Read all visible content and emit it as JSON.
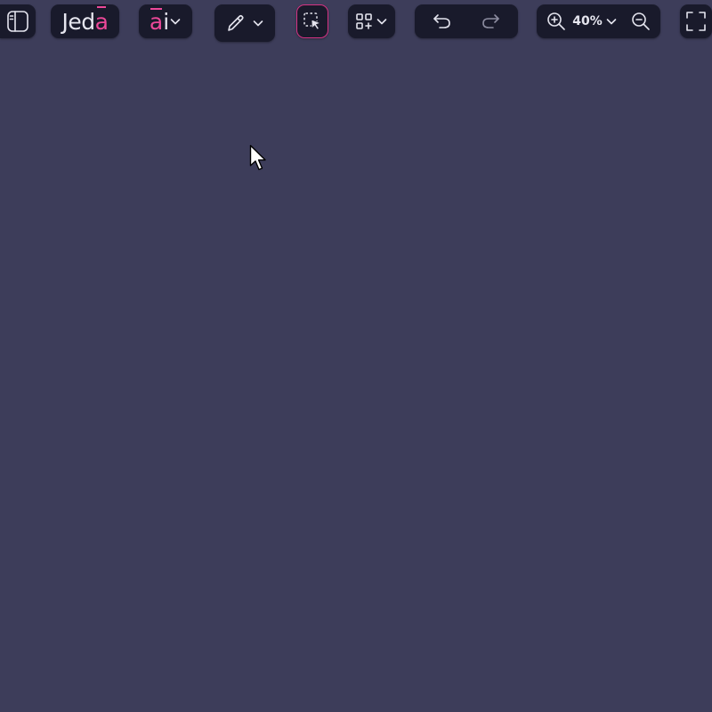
{
  "toolbar": {
    "logo": {
      "main": "Jed",
      "accent": "a"
    },
    "ai": {
      "accent": "a",
      "rest": "i"
    },
    "zoom": {
      "level": "40%"
    }
  },
  "colors": {
    "canvas": "#3d3d5a",
    "toolbar_bg": "#191a2b",
    "accent": "#ec4899",
    "icon": "#e4e4ee",
    "icon_disabled": "#8c8ca0"
  },
  "icons": {
    "sidebar": "sidebar-toggle-icon",
    "ai_dropdown": "chevron-down-icon",
    "pen": "pencil-icon",
    "select": "selection-cursor-icon",
    "shapes": "shapes-grid-icon",
    "undo": "undo-icon",
    "redo": "redo-icon",
    "zoom_in": "zoom-in-icon",
    "zoom_out": "zoom-out-icon",
    "fullscreen": "fullscreen-icon",
    "pointer": "mouse-pointer-icon"
  },
  "state": {
    "redo_enabled": false,
    "select_active": true
  }
}
